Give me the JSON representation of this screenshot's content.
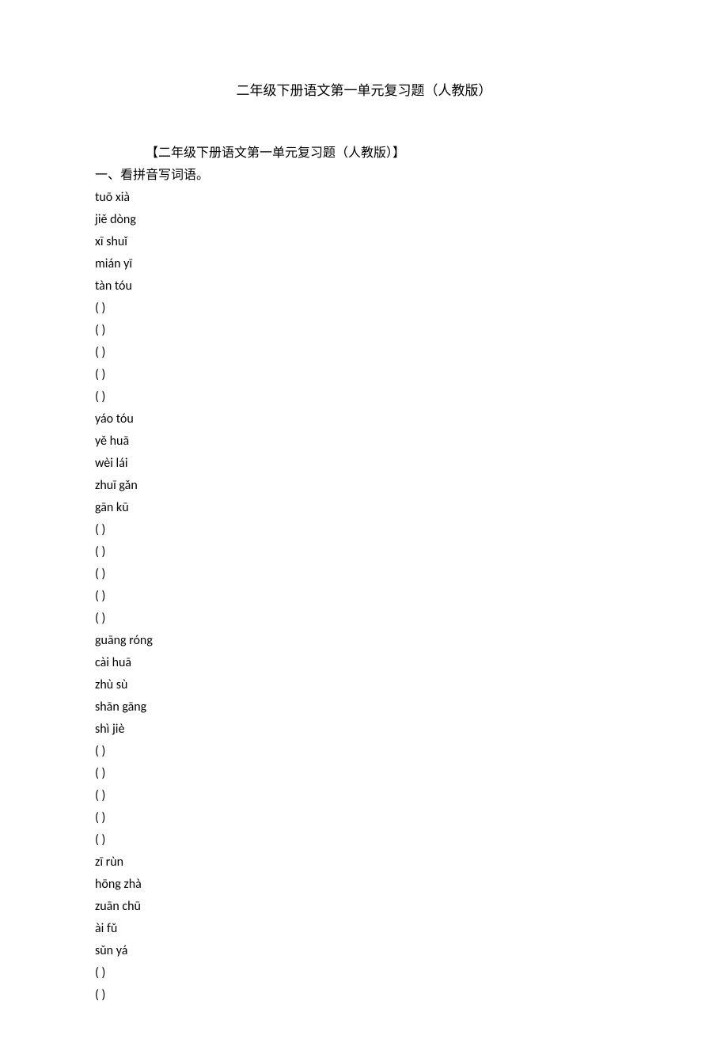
{
  "title": "二年级下册语文第一单元复习题（人教版）",
  "subtitle": "【二年级下册语文第一单元复习题（人教版）】",
  "section1_heading": "一、看拼音写词语。",
  "blank": "( )",
  "groups": [
    {
      "pinyin": [
        "tuō xià",
        "jiě dòng",
        "xī shuǐ",
        "mián yī",
        "tàn tóu"
      ],
      "blanks": 5
    },
    {
      "pinyin": [
        "yáo tóu",
        "yě huā",
        "wèi lái",
        "zhuī gǎn",
        "gān kū"
      ],
      "blanks": 5
    },
    {
      "pinyin": [
        "guāng róng",
        "cài huā",
        "zhù sù",
        "shān gāng",
        "shì jiè"
      ],
      "blanks": 5
    },
    {
      "pinyin": [
        "zī rùn",
        "hōng zhà",
        "zuān chū",
        "ài fǔ",
        "sǔn yá"
      ],
      "blanks": 2
    }
  ]
}
